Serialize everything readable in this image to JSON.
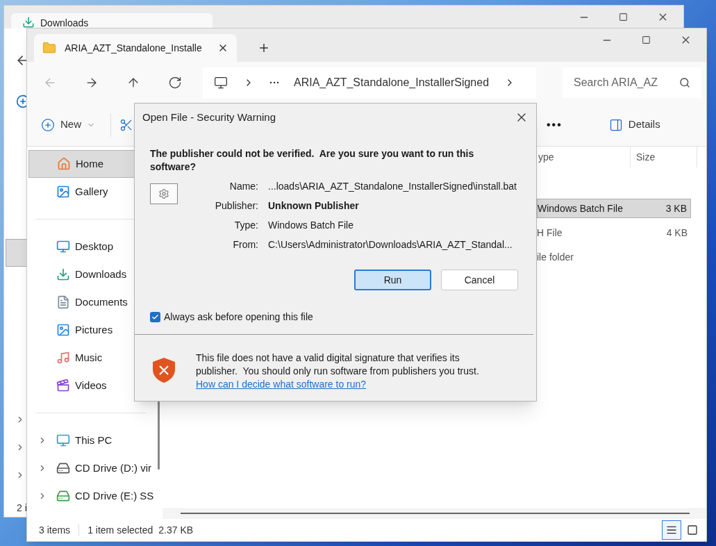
{
  "back_window": {
    "tab": {
      "label": "Downloads"
    },
    "status_text": "2 i"
  },
  "window": {
    "tabs": [
      {
        "label": "ARIA_AZT_Standalone_Installe",
        "selected": true
      }
    ],
    "nav_buttons": [
      {
        "kind": "back",
        "disabled": true
      },
      {
        "kind": "forward",
        "disabled": false
      },
      {
        "kind": "up",
        "disabled": false
      },
      {
        "kind": "refresh",
        "disabled": false
      }
    ],
    "address": {
      "overflow": "···",
      "segment": "ARIA_AZT_Standalone_InstallerSigned"
    },
    "search": {
      "placeholder": "Search ARIA_AZ"
    },
    "command_bar": {
      "new_label": "New",
      "more": "•••",
      "details_label": "Details"
    },
    "sidebar": {
      "groups": [
        [
          {
            "kind": "home",
            "label": "Home",
            "selected": true
          },
          {
            "kind": "gallery",
            "label": "Gallery",
            "selected": false
          }
        ],
        [
          {
            "kind": "desktop",
            "label": "Desktop",
            "selected": false
          },
          {
            "kind": "downloads",
            "label": "Downloads",
            "selected": false
          },
          {
            "kind": "documents",
            "label": "Documents",
            "selected": false
          },
          {
            "kind": "pictures",
            "label": "Pictures",
            "selected": false
          },
          {
            "kind": "music",
            "label": "Music",
            "selected": false
          },
          {
            "kind": "videos",
            "label": "Videos",
            "selected": false
          }
        ],
        [
          {
            "kind": "pc",
            "label": "This PC",
            "selected": false
          },
          {
            "kind": "drive",
            "label": "CD Drive (D:) vir",
            "selected": false
          },
          {
            "kind": "setup-drive",
            "label": "CD Drive (E:) SS",
            "selected": false
          }
        ]
      ]
    },
    "columns": [
      {
        "label": "ype"
      },
      {
        "label": "Size"
      }
    ],
    "rows": [
      {
        "type": "Windows Batch File",
        "size": "3 KB",
        "selected": true
      },
      {
        "type": "H File",
        "size": "4 KB",
        "selected": false
      },
      {
        "type": "ile folder",
        "selected": false
      }
    ],
    "status_bar": {
      "item_count": "3 items",
      "selection": "1 item selected",
      "selection_size": "2.37 KB"
    },
    "view_buttons": [
      {
        "kind": "details",
        "selected": true
      },
      {
        "kind": "tiles",
        "selected": false
      }
    ]
  },
  "dialog": {
    "title": "Open File - Security Warning",
    "heading": "The publisher could not be verified.  Are you sure you want to run this software?",
    "fields": [
      {
        "label": "Name:",
        "value": "...loads\\ARIA_AZT_Standalone_InstallerSigned\\install.bat",
        "bold": false
      },
      {
        "label": "Publisher:",
        "value": "Unknown Publisher",
        "bold": true
      },
      {
        "label": "Type:",
        "value": "Windows Batch File",
        "bold": false
      },
      {
        "label": "From:",
        "value": "C:\\Users\\Administrator\\Downloads\\ARIA_AZT_Standal...",
        "bold": false
      }
    ],
    "buttons": [
      {
        "label": "Run",
        "default": true
      },
      {
        "label": "Cancel",
        "default": false
      }
    ],
    "checkbox": {
      "label": "Always ask before opening this file",
      "checked": true
    },
    "warning": {
      "text": "This file does not have a valid digital signature that verifies its publisher.  You should only run software from publishers you trust.",
      "link": "How can I decide what software to run?"
    }
  }
}
